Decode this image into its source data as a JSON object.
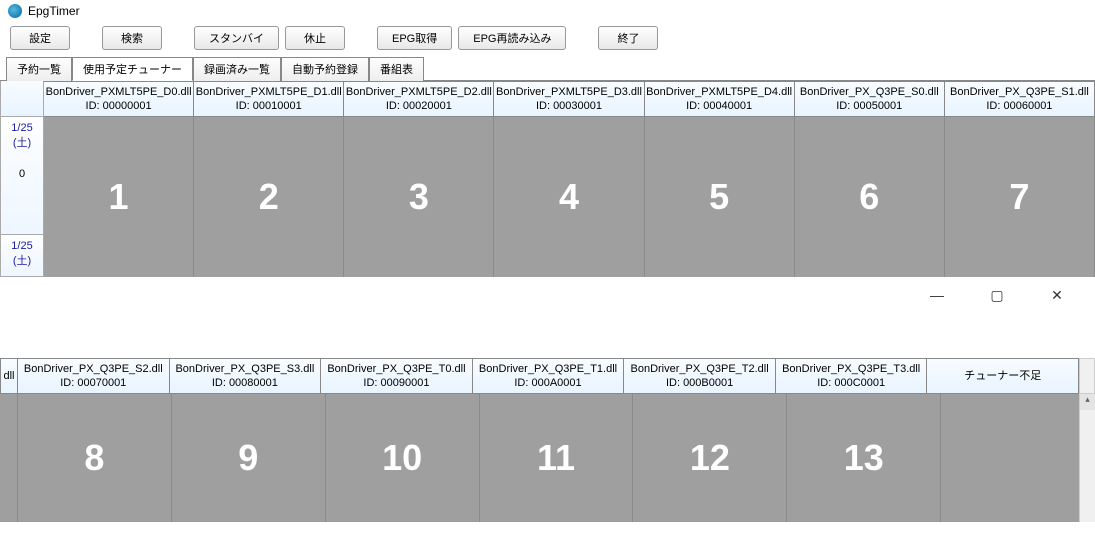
{
  "title": "EpgTimer",
  "toolbar": {
    "settings": "設定",
    "search": "検索",
    "standby": "スタンバイ",
    "pause": "休止",
    "epg_get": "EPG取得",
    "epg_reload": "EPG再読み込み",
    "exit": "終了"
  },
  "tabs": {
    "reserve_list": "予約一覧",
    "tuner_schedule": "使用予定チューナー",
    "recorded_list": "録画済み一覧",
    "auto_reserve": "自動予約登録",
    "program_guide": "番組表"
  },
  "time": {
    "date1": "1/25",
    "dow1": "(土)",
    "hour1": "0",
    "date2": "1/25",
    "dow2": "(土)"
  },
  "tuners_row1": [
    {
      "name": "BonDriver_PXMLT5PE_D0.dll",
      "id": "ID: 00000001",
      "num": "1"
    },
    {
      "name": "BonDriver_PXMLT5PE_D1.dll",
      "id": "ID: 00010001",
      "num": "2"
    },
    {
      "name": "BonDriver_PXMLT5PE_D2.dll",
      "id": "ID: 00020001",
      "num": "3"
    },
    {
      "name": "BonDriver_PXMLT5PE_D3.dll",
      "id": "ID: 00030001",
      "num": "4"
    },
    {
      "name": "BonDriver_PXMLT5PE_D4.dll",
      "id": "ID: 00040001",
      "num": "5"
    },
    {
      "name": "BonDriver_PX_Q3PE_S0.dll",
      "id": "ID: 00050001",
      "num": "6"
    },
    {
      "name": "BonDriver_PX_Q3PE_S1.dll",
      "id": "ID: 00060001",
      "num": "7"
    }
  ],
  "row2_prefix": "dll",
  "tuners_row2": [
    {
      "name": "BonDriver_PX_Q3PE_S2.dll",
      "id": "ID: 00070001",
      "num": "8"
    },
    {
      "name": "BonDriver_PX_Q3PE_S3.dll",
      "id": "ID: 00080001",
      "num": "9"
    },
    {
      "name": "BonDriver_PX_Q3PE_T0.dll",
      "id": "ID: 00090001",
      "num": "10"
    },
    {
      "name": "BonDriver_PX_Q3PE_T1.dll",
      "id": "ID: 000A0001",
      "num": "11"
    },
    {
      "name": "BonDriver_PX_Q3PE_T2.dll",
      "id": "ID: 000B0001",
      "num": "12"
    },
    {
      "name": "BonDriver_PX_Q3PE_T3.dll",
      "id": "ID: 000C0001",
      "num": "13"
    }
  ],
  "tuner_shortage": "チューナー不足"
}
